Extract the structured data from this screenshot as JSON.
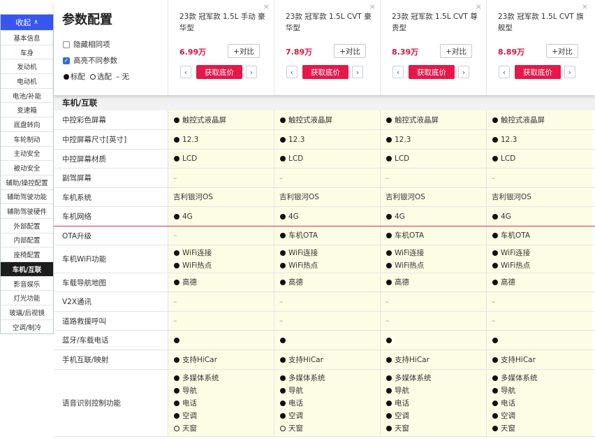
{
  "nav": {
    "collapse_label": "收起",
    "items": [
      "基本信息",
      "车身",
      "发动机",
      "电动机",
      "电池/补能",
      "变速箱",
      "底盘转向",
      "车轮制动",
      "主动安全",
      "被动安全",
      "辅助/操控配置",
      "辅助驾驶功能",
      "辅助驾驶硬件",
      "外部配置",
      "内部配置",
      "座椅配置",
      "车机/互联",
      "影音娱乐",
      "灯光功能",
      "玻璃/后视镜",
      "空调/制冷"
    ],
    "active_index": 16
  },
  "header": {
    "title": "参数配置",
    "hide_same_label": "隐藏相同项",
    "highlight_diff_label": "高亮不同参数",
    "legend": {
      "standard": "标配",
      "optional": "选配",
      "none": "– 无"
    }
  },
  "cars": [
    {
      "name": "23款 冠军款 1.5L 手动 豪华型",
      "price": "6.99万"
    },
    {
      "name": "23款 冠军款 1.5L CVT 豪华型",
      "price": "7.89万"
    },
    {
      "name": "23款 冠军款 1.5L CVT 尊贵型",
      "price": "8.39万"
    },
    {
      "name": "23款 冠军款 1.5L CVT 旗舰型",
      "price": "8.89万"
    }
  ],
  "buttons": {
    "compare": "+对比",
    "get_price": "获取底价",
    "close": "×",
    "prev": "‹",
    "next": "›"
  },
  "section_title": "车机/互联",
  "rows": [
    {
      "label": "中控彩色屏幕",
      "h": 28,
      "cells": [
        [
          [
            "d",
            "触控式液晶屏"
          ]
        ],
        [
          [
            "d",
            "触控式液晶屏"
          ]
        ],
        [
          [
            "d",
            "触控式液晶屏"
          ]
        ],
        [
          [
            "d",
            "触控式液晶屏"
          ]
        ]
      ]
    },
    {
      "label": "中控屏幕尺寸[英寸]",
      "h": 28,
      "cells": [
        [
          [
            "d",
            "12.3"
          ]
        ],
        [
          [
            "d",
            "12.3"
          ]
        ],
        [
          [
            "d",
            "12.3"
          ]
        ],
        [
          [
            "d",
            "12.3"
          ]
        ]
      ]
    },
    {
      "label": "中控屏幕材质",
      "h": 27,
      "cells": [
        [
          [
            "d",
            "LCD"
          ]
        ],
        [
          [
            "d",
            "LCD"
          ]
        ],
        [
          [
            "d",
            "LCD"
          ]
        ],
        [
          [
            "d",
            "LCD"
          ]
        ]
      ]
    },
    {
      "label": "副驾屏幕",
      "h": 28,
      "cells": [
        [
          [
            "x",
            "–"
          ]
        ],
        [
          [
            "x",
            "–"
          ]
        ],
        [
          [
            "x",
            "–"
          ]
        ],
        [
          [
            "x",
            "–"
          ]
        ]
      ]
    },
    {
      "label": "车机系统",
      "h": 27,
      "cells": [
        [
          [
            "t",
            "吉利银河OS"
          ]
        ],
        [
          [
            "t",
            "吉利银河OS"
          ]
        ],
        [
          [
            "t",
            "吉利银河OS"
          ]
        ],
        [
          [
            "t",
            "吉利银河OS"
          ]
        ]
      ]
    },
    {
      "label": "车机网络",
      "h": 28,
      "sep": true,
      "cells": [
        [
          [
            "d",
            "4G"
          ]
        ],
        [
          [
            "d",
            "4G"
          ]
        ],
        [
          [
            "d",
            "4G"
          ]
        ],
        [
          [
            "d",
            "4G"
          ]
        ]
      ]
    },
    {
      "label": "OTA升级",
      "h": 27,
      "cells": [
        [
          [
            "x",
            "–"
          ]
        ],
        [
          [
            "d",
            "车机OTA"
          ]
        ],
        [
          [
            "d",
            "车机OTA"
          ]
        ],
        [
          [
            "d",
            "车机OTA"
          ]
        ]
      ]
    },
    {
      "label": "车机WiFi功能",
      "h": 40,
      "cells": [
        [
          [
            "d",
            "WiFi连接"
          ],
          [
            "d",
            "WiFi热点"
          ]
        ],
        [
          [
            "d",
            "WiFi连接"
          ],
          [
            "d",
            "WiFi热点"
          ]
        ],
        [
          [
            "d",
            "WiFi连接"
          ],
          [
            "d",
            "WiFi热点"
          ]
        ],
        [
          [
            "d",
            "WiFi连接"
          ],
          [
            "d",
            "WiFi热点"
          ]
        ]
      ]
    },
    {
      "label": "车载导航地图",
      "h": 27,
      "cells": [
        [
          [
            "d",
            "高德"
          ]
        ],
        [
          [
            "d",
            "高德"
          ]
        ],
        [
          [
            "d",
            "高德"
          ]
        ],
        [
          [
            "d",
            "高德"
          ]
        ]
      ]
    },
    {
      "label": "V2X通讯",
      "h": 28,
      "cells": [
        [
          [
            "x",
            "–"
          ]
        ],
        [
          [
            "x",
            "–"
          ]
        ],
        [
          [
            "x",
            "–"
          ]
        ],
        [
          [
            "x",
            "–"
          ]
        ]
      ]
    },
    {
      "label": "道路救援呼叫",
      "h": 27,
      "cells": [
        [
          [
            "x",
            "–"
          ]
        ],
        [
          [
            "x",
            "–"
          ]
        ],
        [
          [
            "x",
            "–"
          ]
        ],
        [
          [
            "x",
            "–"
          ]
        ]
      ]
    },
    {
      "label": "蓝牙/车载电话",
      "h": 28,
      "cells": [
        [
          [
            "d",
            ""
          ]
        ],
        [
          [
            "d",
            ""
          ]
        ],
        [
          [
            "d",
            ""
          ]
        ],
        [
          [
            "d",
            ""
          ]
        ]
      ]
    },
    {
      "label": "手机互联/映射",
      "h": 28,
      "cells": [
        [
          [
            "d",
            "支持HiCar"
          ]
        ],
        [
          [
            "d",
            "支持HiCar"
          ]
        ],
        [
          [
            "d",
            "支持HiCar"
          ]
        ],
        [
          [
            "d",
            "支持HiCar"
          ]
        ]
      ]
    },
    {
      "label": "语音识别控制功能",
      "h": 96,
      "cells": [
        [
          [
            "d",
            "多媒体系统"
          ],
          [
            "d",
            "导航"
          ],
          [
            "d",
            "电话"
          ],
          [
            "d",
            "空调"
          ],
          [
            "o",
            "天窗"
          ]
        ],
        [
          [
            "d",
            "多媒体系统"
          ],
          [
            "d",
            "导航"
          ],
          [
            "d",
            "电话"
          ],
          [
            "d",
            "空调"
          ],
          [
            "o",
            "天窗"
          ]
        ],
        [
          [
            "d",
            "多媒体系统"
          ],
          [
            "d",
            "导航"
          ],
          [
            "d",
            "电话"
          ],
          [
            "d",
            "空调"
          ],
          [
            "d",
            "天窗"
          ]
        ],
        [
          [
            "d",
            "多媒体系统"
          ],
          [
            "d",
            "导航"
          ],
          [
            "d",
            "电话"
          ],
          [
            "d",
            "空调"
          ],
          [
            "d",
            "天窗"
          ]
        ]
      ]
    }
  ]
}
